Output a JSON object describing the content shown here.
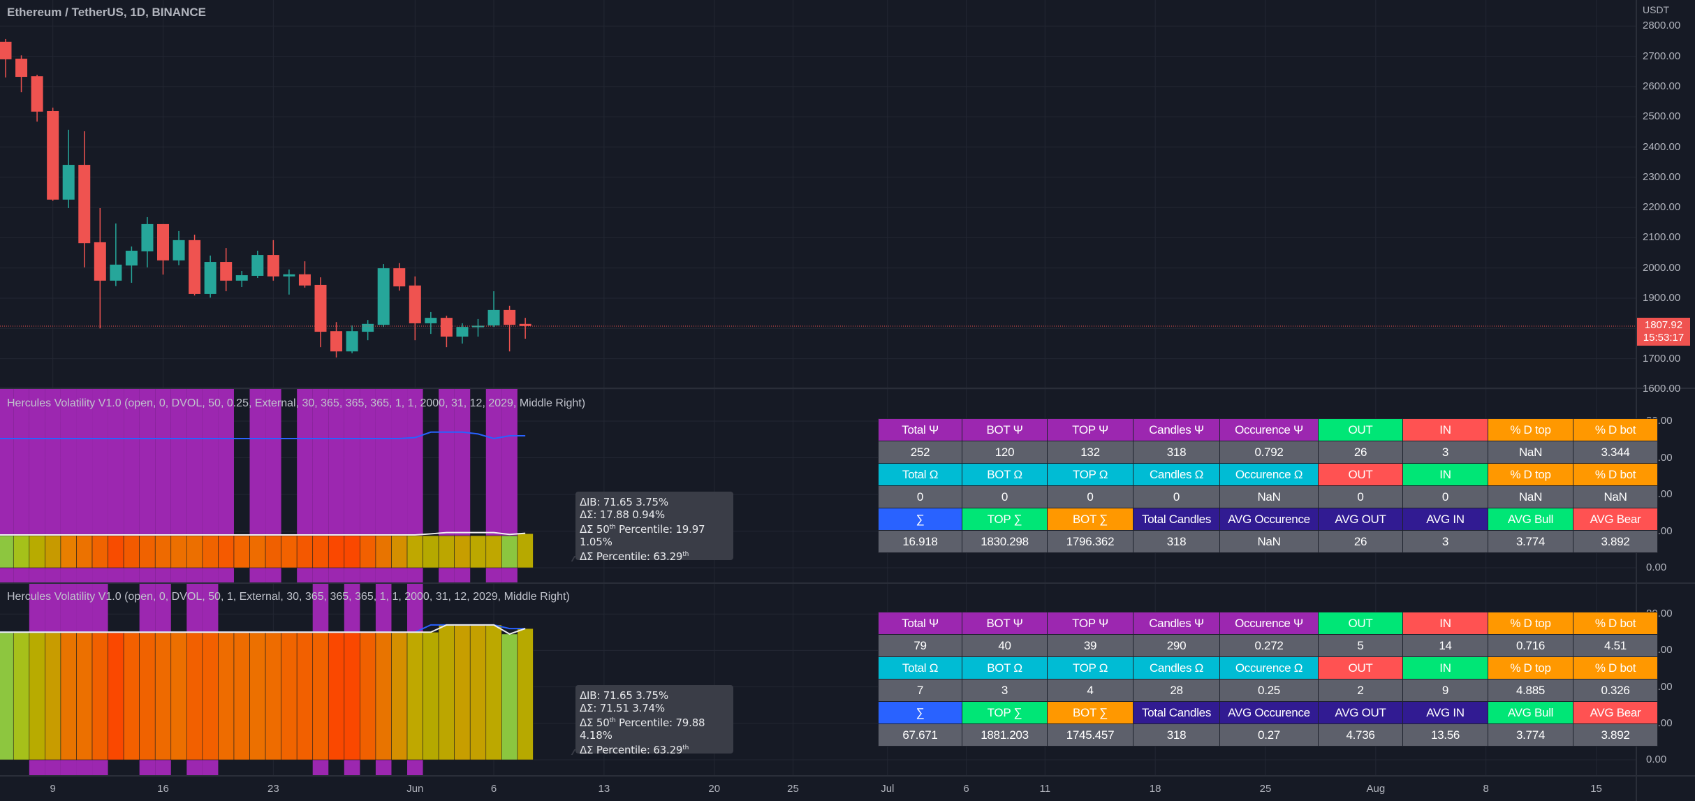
{
  "header": {
    "symbol_title": "Ethereum / TetherUS, 1D, BINANCE",
    "currency": "USDT"
  },
  "price_axis": {
    "ticks": [
      "2800.00",
      "2700.00",
      "2600.00",
      "2500.00",
      "2400.00",
      "2300.00",
      "2200.00",
      "2100.00",
      "2000.00",
      "1900.00",
      "1700.00",
      "1600.00"
    ],
    "last_price": "1807.92",
    "countdown": "15:53:17"
  },
  "colors": {
    "up": "#26a69a",
    "down": "#ef5350",
    "highlight": "#9c27b0",
    "blue_line": "#2962ff",
    "white_line": "#f0f0f0",
    "background": "#161a25"
  },
  "candles": {
    "dates": [
      "05-06",
      "05-07",
      "05-08",
      "05-09",
      "05-10",
      "05-11",
      "05-12",
      "05-13",
      "05-14",
      "05-15",
      "05-16",
      "05-17",
      "05-18",
      "05-19",
      "05-20",
      "05-21",
      "05-22",
      "05-23",
      "05-24",
      "05-25",
      "05-26",
      "05-27",
      "05-28",
      "05-29",
      "05-30",
      "05-31",
      "06-01",
      "06-02",
      "06-03",
      "06-04",
      "06-05",
      "06-06",
      "06-07",
      "06-08"
    ],
    "open": [
      2748,
      2692,
      2634,
      2519,
      2226,
      2341,
      2085,
      1958,
      2008,
      2055,
      2145,
      2025,
      2092,
      1914,
      2020,
      1958,
      1974,
      2043,
      1972,
      1979,
      1944,
      1791,
      1724,
      1789,
      1812,
      1999,
      1942,
      1817,
      1835,
      1773,
      1804,
      1810,
      1861,
      1815
    ],
    "high": [
      2757,
      2703,
      2639,
      2530,
      2457,
      2452,
      2198,
      2147,
      2071,
      2168,
      2145,
      2122,
      2110,
      2041,
      2066,
      1990,
      2057,
      2092,
      1995,
      2022,
      1969,
      1821,
      1810,
      1828,
      2013,
      2016,
      1972,
      1854,
      1842,
      1817,
      1831,
      1923,
      1875,
      1835
    ],
    "low": [
      2630,
      2581,
      2484,
      2222,
      2198,
      2002,
      1800,
      1940,
      1951,
      2002,
      1978,
      2009,
      1909,
      1902,
      1923,
      1937,
      1967,
      1958,
      1912,
      1935,
      1738,
      1704,
      1718,
      1761,
      1805,
      1925,
      1761,
      1782,
      1738,
      1750,
      1773,
      1805,
      1724,
      1766
    ],
    "close": [
      2690,
      2632,
      2517,
      2226,
      2341,
      2082,
      1958,
      2011,
      2057,
      2145,
      2025,
      2092,
      1914,
      2020,
      1958,
      1976,
      2043,
      1972,
      1979,
      1942,
      1789,
      1724,
      1791,
      1815,
      1999,
      1939,
      1817,
      1835,
      1773,
      1805,
      1809,
      1861,
      1812,
      1808
    ]
  },
  "time_axis": [
    {
      "label": "9",
      "date": "05-09"
    },
    {
      "label": "16",
      "date": "05-16"
    },
    {
      "label": "23",
      "date": "05-23"
    },
    {
      "label": "Jun",
      "date": "06-01"
    },
    {
      "label": "6",
      "date": "06-06"
    },
    {
      "label": "13",
      "date": "06-13"
    },
    {
      "label": "20",
      "date": "06-20"
    },
    {
      "label": "25",
      "date": "06-25"
    },
    {
      "label": "Jul",
      "date": "07-01"
    },
    {
      "label": "6",
      "date": "07-06"
    },
    {
      "label": "11",
      "date": "07-11"
    },
    {
      "label": "18",
      "date": "07-18"
    },
    {
      "label": "25",
      "date": "07-25"
    },
    {
      "label": "Aug",
      "date": "08-01"
    },
    {
      "label": "8",
      "date": "08-08"
    },
    {
      "label": "15",
      "date": "08-15"
    }
  ],
  "indicators": [
    {
      "title": "Hercules Volatility V1.0 (open, 0, DVOL, 50, 0.25, External, 30, 365, 365, 365, 1, 1, 2000, 31, 12, 2029, Middle Right)",
      "axis": [
        "80.00",
        "60.00",
        "40.00",
        "20.00",
        "0.00"
      ],
      "highlighted": [
        1,
        1,
        1,
        1,
        1,
        1,
        1,
        1,
        1,
        1,
        1,
        1,
        1,
        1,
        1,
        0,
        1,
        1,
        0,
        1,
        1,
        1,
        1,
        1,
        1,
        1,
        1,
        0,
        1,
        1,
        0,
        1,
        1,
        0
      ],
      "bars": [
        17.5,
        17.5,
        17.5,
        17.5,
        17.5,
        17.5,
        17.5,
        17.5,
        17.5,
        17.5,
        17.5,
        17.5,
        17.5,
        17.5,
        17.5,
        17.5,
        17.5,
        17.5,
        17.5,
        17.5,
        17.5,
        17.5,
        17.5,
        17.5,
        17.5,
        17.5,
        17.5,
        17.5,
        17.5,
        17.5,
        17.5,
        17.5,
        17.5,
        18.6
      ],
      "bar_colors": [
        "#8dc63f",
        "#a5c11a",
        "#b8ab00",
        "#c79a00",
        "#e87f00",
        "#ec7200",
        "#f06300",
        "#f84c00",
        "#f25a00",
        "#f06200",
        "#ee6a00",
        "#ec6f00",
        "#ec6f00",
        "#f06300",
        "#f55a00",
        "#f26500",
        "#ee6c00",
        "#f06000",
        "#f26200",
        "#f45800",
        "#f55500",
        "#fa4800",
        "#fa4800",
        "#f26000",
        "#e87400",
        "#d48f00",
        "#bfa800",
        "#b5a900",
        "#bca600",
        "#c79e00",
        "#bca800",
        "#bfa700",
        "#8bc63f",
        "#b7a900"
      ],
      "white_line": [
        17.9,
        17.9,
        17.9,
        17.9,
        17.9,
        17.9,
        17.9,
        17.9,
        17.9,
        17.9,
        17.9,
        17.9,
        17.9,
        17.9,
        17.9,
        17.9,
        17.9,
        17.9,
        17.9,
        17.9,
        17.9,
        17.9,
        17.9,
        17.9,
        17.9,
        17.9,
        17.9,
        18.5,
        19.2,
        19.2,
        19.2,
        19.2,
        18.2,
        18.8
      ],
      "blue_line": [
        70.5,
        70.5,
        70.5,
        70.5,
        70.5,
        70.5,
        70.5,
        70.5,
        70.5,
        70.5,
        70.5,
        70.5,
        70.5,
        70.5,
        70.5,
        70.5,
        70.5,
        70.5,
        70.5,
        70.5,
        70.5,
        70.5,
        70.5,
        70.5,
        70.5,
        70.5,
        71,
        74,
        74,
        74,
        73,
        70.5,
        72,
        72
      ],
      "tooltip": {
        "l1": "ΔIB: 71.65  3.75%",
        "l2": "ΔΣ: 17.88  0.94%",
        "l3a": "ΔΣ 50",
        "l3sup": "th",
        "l3b": " Percentile: 19.97  1.05%",
        "l4a": "ΔΣ Percentile: 63.29",
        "l4sup": "th"
      },
      "table": [
        [
          {
            "t": "Total Ψ",
            "c": "#9c27b0"
          },
          {
            "t": "BOT Ψ",
            "c": "#9c27b0"
          },
          {
            "t": "TOP Ψ",
            "c": "#9c27b0"
          },
          {
            "t": "Candles Ψ",
            "c": "#9c27b0"
          },
          {
            "t": "Occurence Ψ",
            "c": "#9c27b0"
          },
          {
            "t": "OUT",
            "c": "#00e676"
          },
          {
            "t": "IN",
            "c": "#ff5252"
          },
          {
            "t": "% D top",
            "c": "#ff9800"
          },
          {
            "t": "% D bot",
            "c": "#ff9800"
          }
        ],
        [
          {
            "t": "252"
          },
          {
            "t": "120"
          },
          {
            "t": "132"
          },
          {
            "t": "318"
          },
          {
            "t": "0.792"
          },
          {
            "t": "26"
          },
          {
            "t": "3"
          },
          {
            "t": "NaN"
          },
          {
            "t": "3.344"
          }
        ],
        [
          {
            "t": "Total Ω",
            "c": "#00bcd4"
          },
          {
            "t": "BOT Ω",
            "c": "#00bcd4"
          },
          {
            "t": "TOP Ω",
            "c": "#00bcd4"
          },
          {
            "t": "Candles Ω",
            "c": "#00bcd4"
          },
          {
            "t": "Occurence Ω",
            "c": "#00bcd4"
          },
          {
            "t": "OUT",
            "c": "#ff5252"
          },
          {
            "t": "IN",
            "c": "#00e676"
          },
          {
            "t": "% D top",
            "c": "#ff9800"
          },
          {
            "t": "% D bot",
            "c": "#ff9800"
          }
        ],
        [
          {
            "t": "0"
          },
          {
            "t": "0"
          },
          {
            "t": "0"
          },
          {
            "t": "0"
          },
          {
            "t": "NaN"
          },
          {
            "t": "0"
          },
          {
            "t": "0"
          },
          {
            "t": "NaN"
          },
          {
            "t": "NaN"
          }
        ],
        [
          {
            "t": "∑",
            "c": "#2962ff"
          },
          {
            "t": "TOP ∑",
            "c": "#00e676"
          },
          {
            "t": "BOT ∑",
            "c": "#ff9800"
          },
          {
            "t": "Total Candles",
            "c": "#311b92"
          },
          {
            "t": "AVG Occurence",
            "c": "#311b92"
          },
          {
            "t": "AVG OUT",
            "c": "#311b92"
          },
          {
            "t": "AVG IN",
            "c": "#311b92"
          },
          {
            "t": "AVG Bull",
            "c": "#00e676"
          },
          {
            "t": "AVG Bear",
            "c": "#ff5252"
          }
        ],
        [
          {
            "t": "16.918"
          },
          {
            "t": "1830.298"
          },
          {
            "t": "1796.362"
          },
          {
            "t": "318"
          },
          {
            "t": "NaN"
          },
          {
            "t": "26"
          },
          {
            "t": "3"
          },
          {
            "t": "3.774"
          },
          {
            "t": "3.892"
          }
        ]
      ]
    },
    {
      "title": "Hercules Volatility V1.0 (open, 0, DVOL, 50, 1, External, 30, 365, 365, 365, 1, 1, 2000, 31, 12, 2029, Middle Right)",
      "axis": [
        "80.00",
        "60.00",
        "40.00",
        "20.00",
        "0.00"
      ],
      "highlighted": [
        0,
        0,
        1,
        1,
        1,
        1,
        1,
        0,
        0,
        1,
        1,
        0,
        1,
        1,
        0,
        0,
        0,
        0,
        0,
        0,
        1,
        0,
        1,
        0,
        1,
        0,
        1,
        0,
        0,
        0,
        0,
        0,
        0,
        0
      ],
      "bars": [
        70,
        70,
        70,
        70,
        70,
        70,
        70,
        70,
        70,
        70,
        70,
        70,
        70,
        70,
        70,
        70,
        70,
        70,
        70,
        70,
        70,
        70,
        70,
        70,
        70,
        70,
        70,
        70,
        74,
        74,
        74,
        74,
        69,
        72
      ],
      "bar_colors": [
        "#8dc63f",
        "#a6c01a",
        "#b8ab00",
        "#c89c00",
        "#e87400",
        "#ec7000",
        "#f06000",
        "#fa4800",
        "#f46000",
        "#f06200",
        "#ee6a00",
        "#ec6f00",
        "#f26000",
        "#f26000",
        "#ee6c00",
        "#ee6c00",
        "#ec7000",
        "#ee6c00",
        "#f06400",
        "#f26000",
        "#f06200",
        "#fa4800",
        "#fa4800",
        "#f06000",
        "#e87400",
        "#d48f00",
        "#bfa800",
        "#b5a900",
        "#bca600",
        "#c79e00",
        "#c4a000",
        "#bca800",
        "#8bc63f",
        "#b7a900"
      ],
      "white_line": [
        70,
        70,
        70,
        70,
        70,
        70,
        70,
        70,
        70,
        70,
        70,
        70,
        70,
        70,
        70,
        70,
        70,
        70,
        70,
        70,
        70,
        70,
        70,
        70,
        70,
        70,
        70,
        70,
        74,
        74,
        74,
        74,
        69,
        72
      ],
      "blue_line": [
        70,
        70,
        70,
        70,
        70,
        70,
        70,
        70,
        70,
        70,
        70,
        70,
        70,
        70,
        70,
        70,
        70,
        70,
        70,
        70,
        70,
        70,
        70,
        70,
        70,
        70,
        70,
        74,
        74,
        74,
        74,
        74,
        72,
        72
      ],
      "tooltip": {
        "l1": "ΔIB: 71.65  3.75%",
        "l2": "ΔΣ: 71.51  3.74%",
        "l3a": "ΔΣ 50",
        "l3sup": "th",
        "l3b": " Percentile: 79.88  4.18%",
        "l4a": "ΔΣ Percentile: 63.29",
        "l4sup": "th"
      },
      "table": [
        [
          {
            "t": "Total Ψ",
            "c": "#9c27b0"
          },
          {
            "t": "BOT Ψ",
            "c": "#9c27b0"
          },
          {
            "t": "TOP Ψ",
            "c": "#9c27b0"
          },
          {
            "t": "Candles Ψ",
            "c": "#9c27b0"
          },
          {
            "t": "Occurence Ψ",
            "c": "#9c27b0"
          },
          {
            "t": "OUT",
            "c": "#00e676"
          },
          {
            "t": "IN",
            "c": "#ff5252"
          },
          {
            "t": "% D top",
            "c": "#ff9800"
          },
          {
            "t": "% D bot",
            "c": "#ff9800"
          }
        ],
        [
          {
            "t": "79"
          },
          {
            "t": "40"
          },
          {
            "t": "39"
          },
          {
            "t": "290"
          },
          {
            "t": "0.272"
          },
          {
            "t": "5"
          },
          {
            "t": "14"
          },
          {
            "t": "0.716"
          },
          {
            "t": "4.51"
          }
        ],
        [
          {
            "t": "Total Ω",
            "c": "#00bcd4"
          },
          {
            "t": "BOT Ω",
            "c": "#00bcd4"
          },
          {
            "t": "TOP Ω",
            "c": "#00bcd4"
          },
          {
            "t": "Candles Ω",
            "c": "#00bcd4"
          },
          {
            "t": "Occurence Ω",
            "c": "#00bcd4"
          },
          {
            "t": "OUT",
            "c": "#ff5252"
          },
          {
            "t": "IN",
            "c": "#00e676"
          },
          {
            "t": "% D top",
            "c": "#ff9800"
          },
          {
            "t": "% D bot",
            "c": "#ff9800"
          }
        ],
        [
          {
            "t": "7"
          },
          {
            "t": "3"
          },
          {
            "t": "4"
          },
          {
            "t": "28"
          },
          {
            "t": "0.25"
          },
          {
            "t": "2"
          },
          {
            "t": "9"
          },
          {
            "t": "4.885"
          },
          {
            "t": "0.326"
          }
        ],
        [
          {
            "t": "∑",
            "c": "#2962ff"
          },
          {
            "t": "TOP ∑",
            "c": "#00e676"
          },
          {
            "t": "BOT ∑",
            "c": "#ff9800"
          },
          {
            "t": "Total Candles",
            "c": "#311b92"
          },
          {
            "t": "AVG Occurence",
            "c": "#311b92"
          },
          {
            "t": "AVG OUT",
            "c": "#311b92"
          },
          {
            "t": "AVG IN",
            "c": "#311b92"
          },
          {
            "t": "AVG Bull",
            "c": "#00e676"
          },
          {
            "t": "AVG Bear",
            "c": "#ff5252"
          }
        ],
        [
          {
            "t": "67.671"
          },
          {
            "t": "1881.203"
          },
          {
            "t": "1745.457"
          },
          {
            "t": "318"
          },
          {
            "t": "0.27"
          },
          {
            "t": "4.736"
          },
          {
            "t": "13.56"
          },
          {
            "t": "3.774"
          },
          {
            "t": "3.892"
          }
        ]
      ]
    }
  ]
}
